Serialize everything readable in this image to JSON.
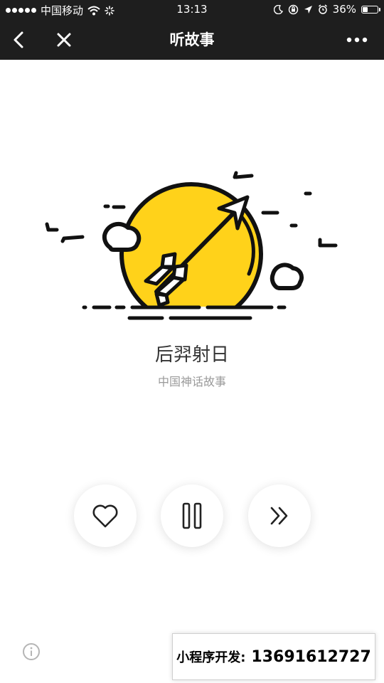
{
  "status_bar": {
    "carrier": "中国移动",
    "time": "13:13",
    "battery_percent": "36%",
    "battery_level": 0.36
  },
  "nav": {
    "title": "听故事"
  },
  "story": {
    "title": "后羿射日",
    "subtitle": "中国神话故事",
    "illustration_icon": "sun-arrow-illustration"
  },
  "controls": [
    {
      "name": "like",
      "icon": "heart-icon"
    },
    {
      "name": "pause",
      "icon": "pause-icon"
    },
    {
      "name": "next",
      "icon": "fast-forward-icon"
    }
  ],
  "footer": {
    "info_icon": "info-icon",
    "promo_label": "小程序开发:",
    "promo_number": "13691612727"
  },
  "colors": {
    "bar_background": "#1e1e1e",
    "sun_yellow": "#ffd21a",
    "line_black": "#111111",
    "title_text": "#333333",
    "subtitle_text": "#9a9a9a"
  }
}
